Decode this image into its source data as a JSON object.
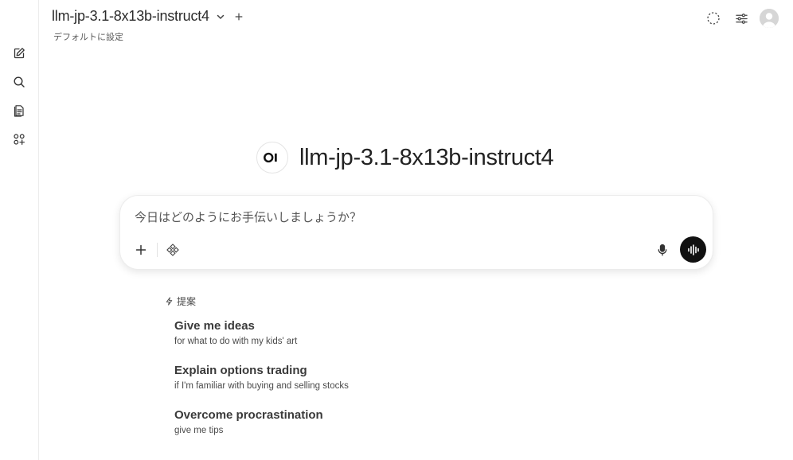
{
  "header": {
    "model_name": "llm-jp-3.1-8x13b-instruct4",
    "set_default_label": "デフォルトに設定"
  },
  "sidebar": {
    "items": [
      {
        "name": "new-chat",
        "icon": "pencil-square-icon"
      },
      {
        "name": "search",
        "icon": "search-icon"
      },
      {
        "name": "notes",
        "icon": "notes-icon"
      },
      {
        "name": "workspace",
        "icon": "apps-icon"
      }
    ]
  },
  "top_right": {
    "icons": [
      "temporary-chat-icon",
      "controls-sliders-icon",
      "user-avatar"
    ]
  },
  "hero": {
    "logo_text": "OI",
    "title": "llm-jp-3.1-8x13b-instruct4"
  },
  "composer": {
    "placeholder": "今日はどのようにお手伝いしましょうか？",
    "value": ""
  },
  "suggestions": {
    "heading": "提案",
    "items": [
      {
        "title": "Give me ideas",
        "subtitle": "for what to do with my kids' art"
      },
      {
        "title": "Explain options trading",
        "subtitle": "if I'm familiar with buying and selling stocks"
      },
      {
        "title": "Overcome procrastination",
        "subtitle": "give me tips"
      }
    ]
  },
  "colors": {
    "accent_dark": "#111111",
    "border": "#ececec",
    "text": "#2b2b2b"
  }
}
